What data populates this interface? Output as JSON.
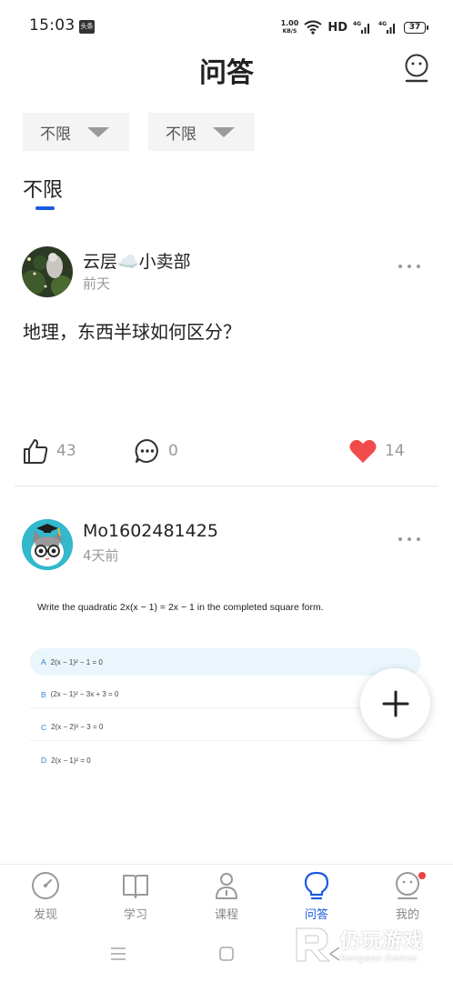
{
  "status_bar": {
    "time": "15:03",
    "app_badge": "头条",
    "net_speed_value": "1.00",
    "net_speed_unit": "KB/S",
    "hd": "HD",
    "battery": "37"
  },
  "header": {
    "title": "问答"
  },
  "filters": [
    {
      "label": "不限"
    },
    {
      "label": "不限"
    }
  ],
  "category_tab": {
    "label": "不限"
  },
  "posts": [
    {
      "author": "云层☁️小卖部",
      "time": "前天",
      "text": "地理，东西半球如何区分？",
      "likes": "43",
      "comments": "0",
      "favorites": "14"
    },
    {
      "author": "Mo1602481425",
      "time": "4天前",
      "quiz": {
        "question": "Write the quadratic 2x(x − 1) = 2x − 1 in the completed square form.",
        "options": [
          {
            "letter": "A",
            "text": "2(x − 1)² − 1 = 0"
          },
          {
            "letter": "B",
            "text": "(2x − 1)² − 3x + 3 = 0"
          },
          {
            "letter": "C",
            "text": "2(x − 2)² − 3 = 0"
          },
          {
            "letter": "D",
            "text": "2(x − 1)² = 0"
          }
        ]
      }
    }
  ],
  "bottom_nav": [
    {
      "label": "发现"
    },
    {
      "label": "学习"
    },
    {
      "label": "课程"
    },
    {
      "label": "问答"
    },
    {
      "label": "我的"
    }
  ],
  "watermark": {
    "cn": "仍玩游戏",
    "en": "Rengwan Games"
  },
  "colors": {
    "accent": "#1a5ae0",
    "heart": "#f04a4a",
    "muted": "#999999"
  }
}
